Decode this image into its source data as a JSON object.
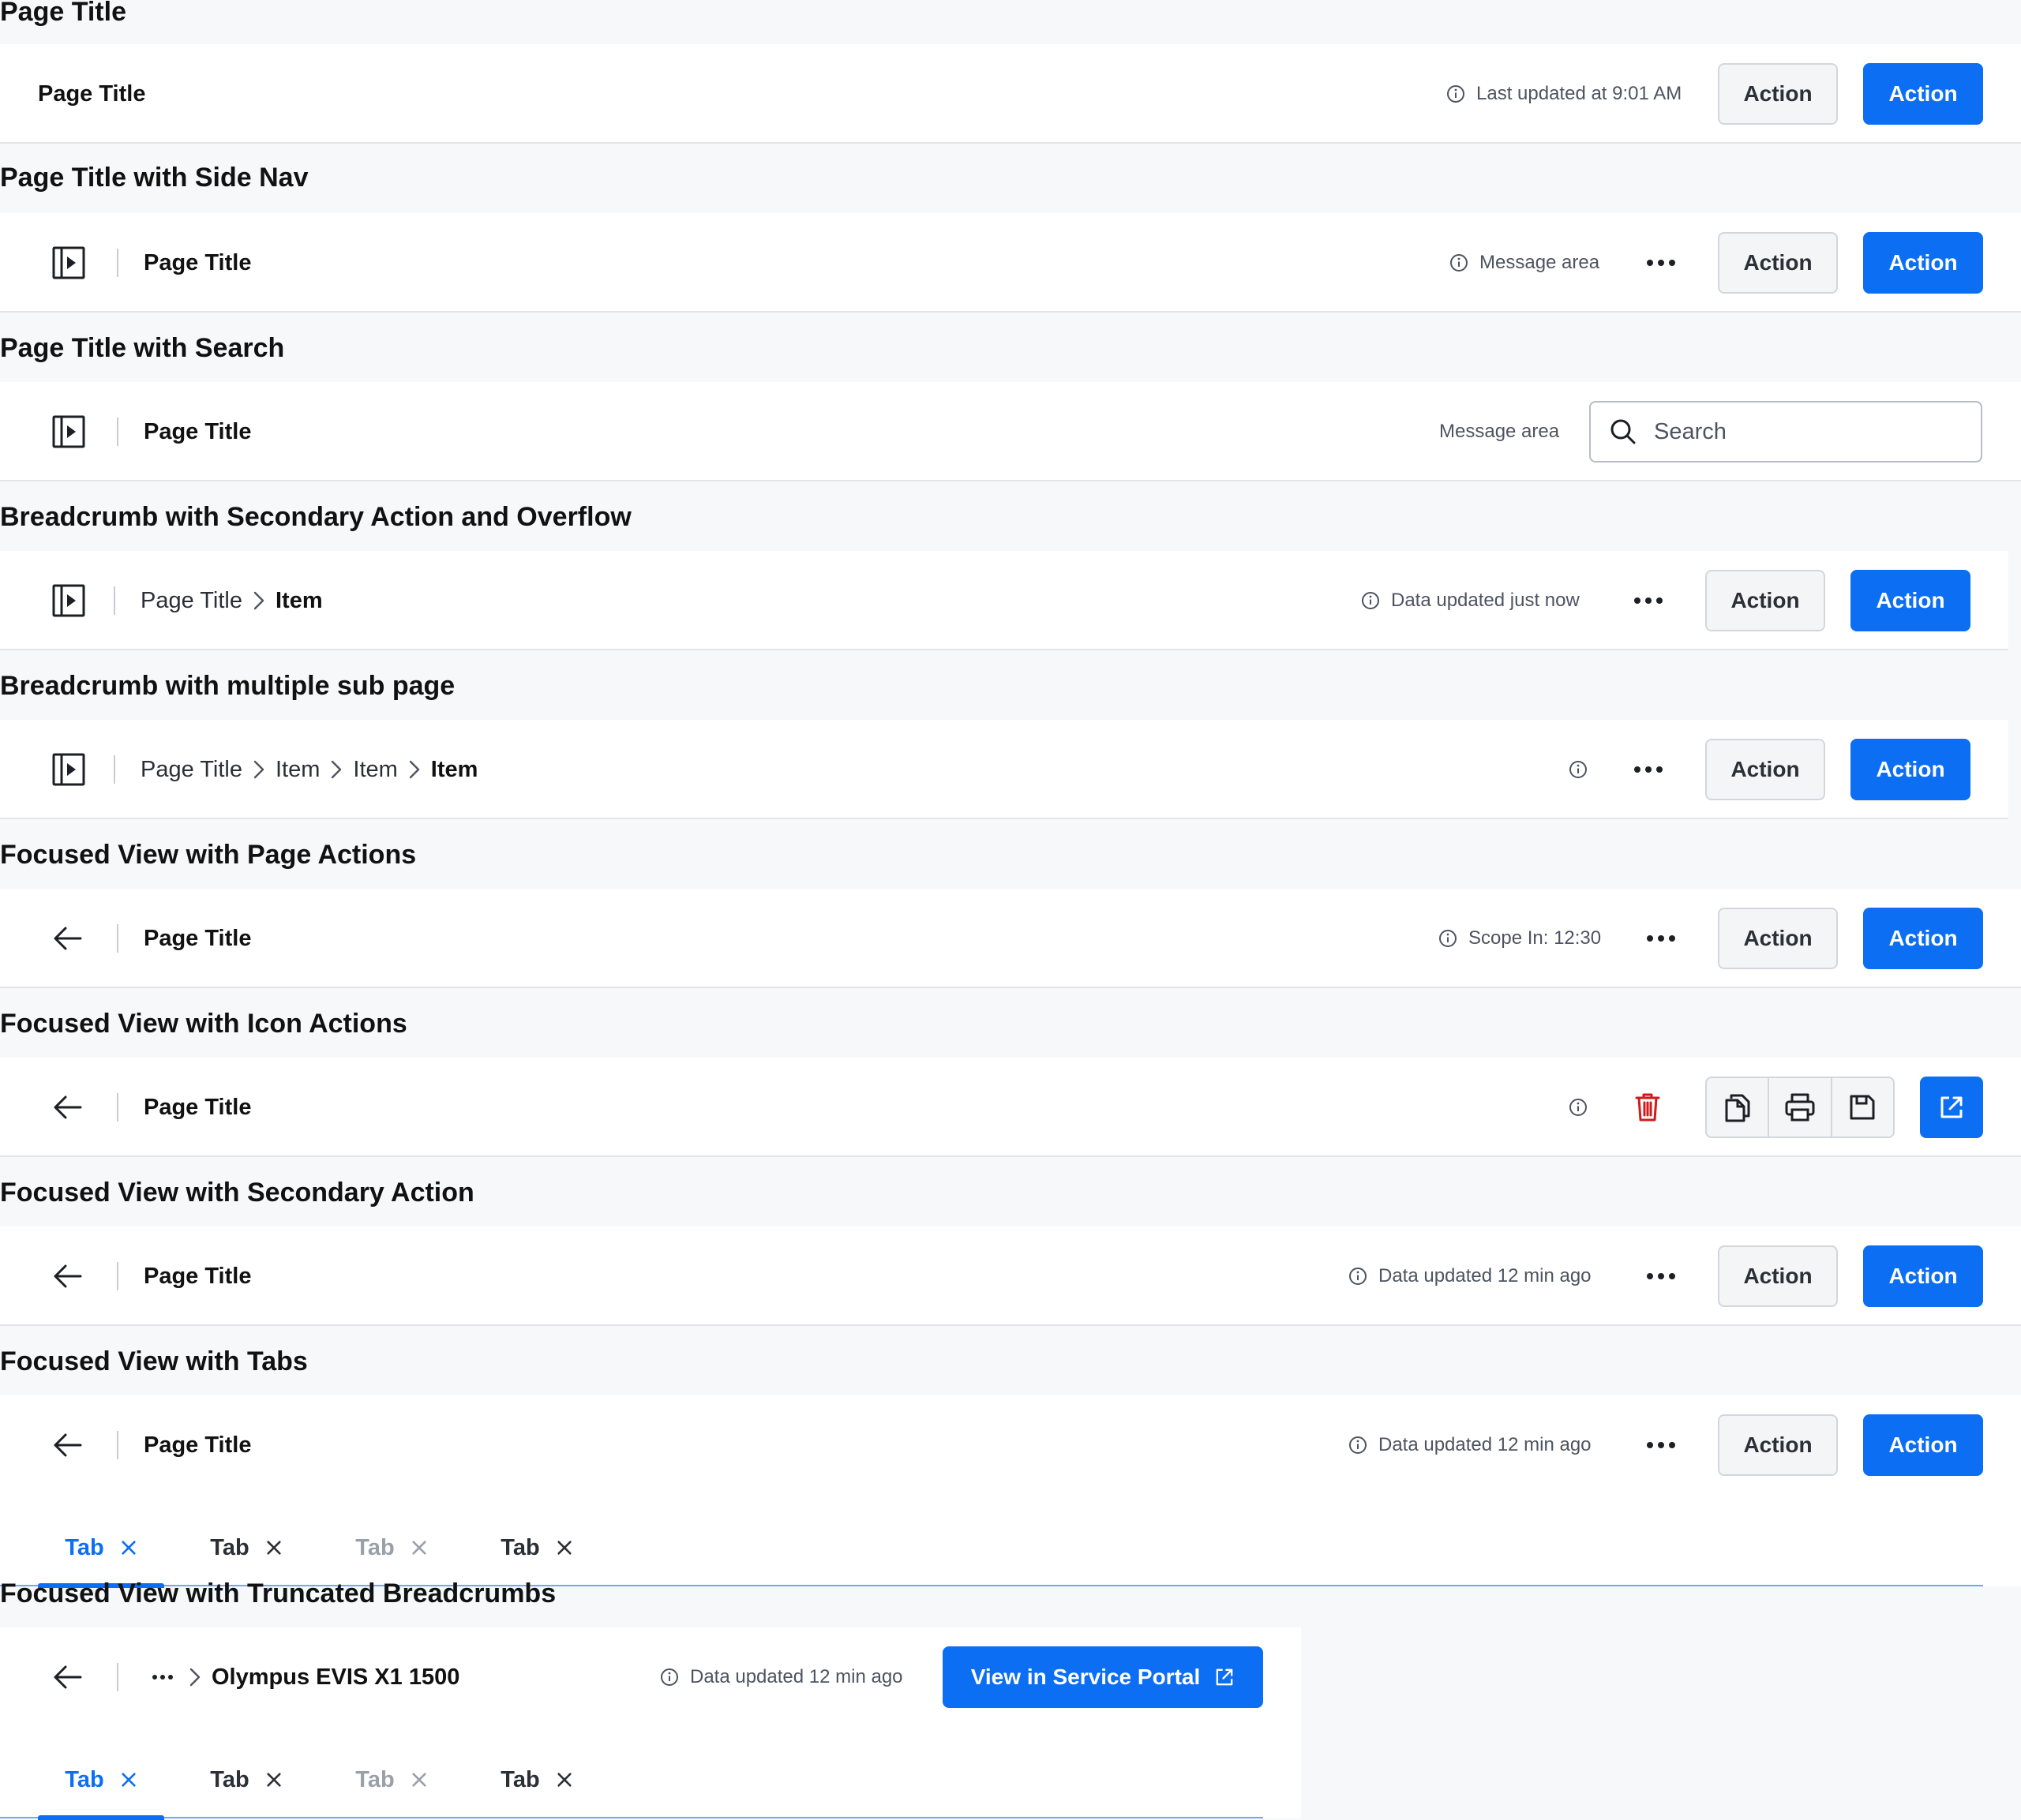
{
  "sections": [
    {
      "title": "Page Title",
      "page_title": "Page Title",
      "message": "Last updated at 9:01 AM",
      "secondary": "Action",
      "primary": "Action"
    },
    {
      "title": "Page Title with Side Nav",
      "page_title": "Page Title",
      "message": "Message area",
      "secondary": "Action",
      "primary": "Action"
    },
    {
      "title": "Page Title with Search",
      "page_title": "Page Title",
      "message": "Message area",
      "search_placeholder": "Search"
    },
    {
      "title": "Breadcrumb with Secondary Action and Overflow",
      "crumbs": [
        "Page Title"
      ],
      "current": "Item",
      "message": "Data updated just now",
      "secondary": "Action",
      "primary": "Action"
    },
    {
      "title": "Breadcrumb with multiple sub page",
      "crumbs": [
        "Page Title",
        "Item",
        "Item"
      ],
      "current": "Item",
      "secondary": "Action",
      "primary": "Action"
    },
    {
      "title": "Focused View with Page Actions",
      "page_title": "Page Title",
      "message": "Scope In: 12:30",
      "secondary": "Action",
      "primary": "Action"
    },
    {
      "title": "Focused View with Icon Actions",
      "page_title": "Page Title"
    },
    {
      "title": "Focused View with Secondary Action",
      "page_title": "Page Title",
      "message": "Data updated 12 min ago",
      "secondary": "Action",
      "primary": "Action"
    },
    {
      "title": "Focused View with Tabs",
      "page_title": "Page Title",
      "message": "Data updated 12 min ago",
      "secondary": "Action",
      "primary": "Action",
      "tabs": [
        "Tab",
        "Tab",
        "Tab",
        "Tab"
      ]
    },
    {
      "title": "Focused View with Truncated Breadcrumbs",
      "current": "Olympus EVIS X1 1500",
      "message": "Data updated 12 min ago",
      "primary": "View in Service Portal",
      "tabs": [
        "Tab",
        "Tab",
        "Tab",
        "Tab"
      ]
    }
  ],
  "icons": {
    "side_nav": "side-nav-toggle-icon",
    "back": "arrow-left-icon",
    "info": "info-icon",
    "overflow": "more-horizontal-icon",
    "search": "search-icon",
    "delete": "trash-icon",
    "copy": "copy-icon",
    "print": "printer-icon",
    "save": "save-icon",
    "external": "external-link-icon",
    "close": "close-icon",
    "chevron": "chevron-right-icon"
  },
  "colors": {
    "primary": "#0b6ef3",
    "danger": "#d11b1b",
    "text": "#111111",
    "muted": "#4d5360",
    "disabled": "#9aa0aa"
  }
}
